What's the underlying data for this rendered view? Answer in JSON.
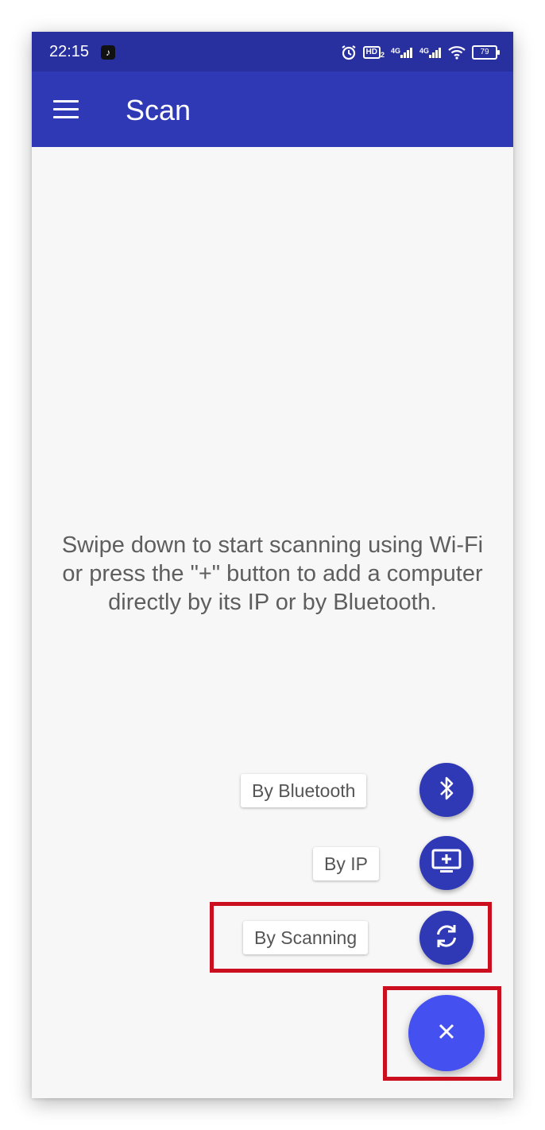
{
  "status_bar": {
    "time": "22:15",
    "icons": [
      "tiktok-icon",
      "alarm-icon",
      "hd-icon",
      "signal-4g-icon",
      "signal-4g-icon",
      "wifi-icon",
      "battery-icon"
    ],
    "hd_label": "HD",
    "hd_sub": "2",
    "net1": "4G",
    "net2": "4G",
    "battery": "79"
  },
  "app_bar": {
    "title": "Scan",
    "background": "#3039b5"
  },
  "main": {
    "message": "Swipe down to start scanning using Wi-Fi or press the \"+\" button to add a computer directly by its IP or by Bluetooth."
  },
  "fab_menu": {
    "bluetooth_label": "By Bluetooth",
    "ip_label": "By IP",
    "scanning_label": "By Scanning",
    "icons": [
      "bluetooth-icon",
      "monitor-add-icon",
      "refresh-icon",
      "close-icon"
    ],
    "accent": "#4450f0"
  },
  "annotations": {
    "highlight_color": "#cc0f1f"
  }
}
